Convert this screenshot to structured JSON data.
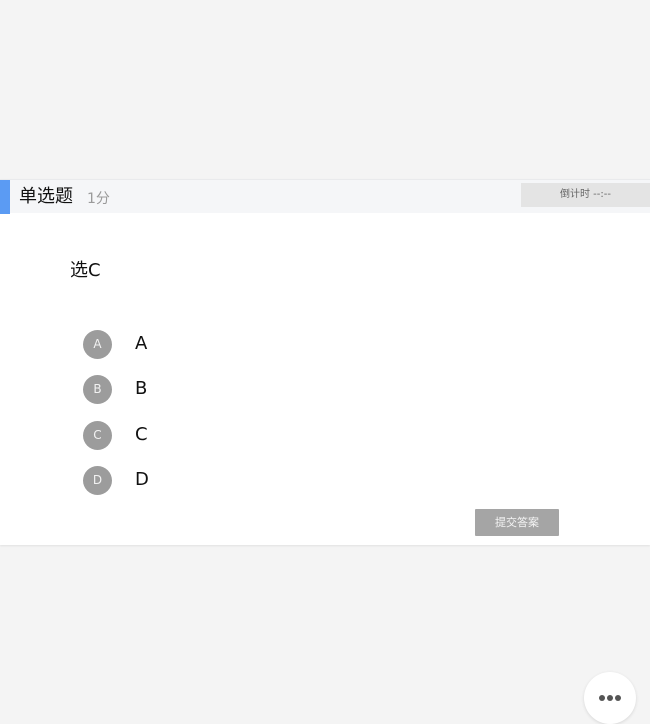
{
  "question": {
    "type_label": "单选题",
    "score_label": "1分",
    "timer_label": "倒计时 --:--",
    "text": "选C",
    "options": [
      {
        "letter": "A",
        "label": "A"
      },
      {
        "letter": "B",
        "label": "B"
      },
      {
        "letter": "C",
        "label": "C"
      },
      {
        "letter": "D",
        "label": "D"
      }
    ],
    "submit_label": "提交答案"
  },
  "fab": {
    "icon": "more-icon"
  },
  "colors": {
    "accent": "#5b9bf3",
    "option_circle": "#9c9c9c",
    "submit_button": "#a5a5a5",
    "page_background": "#f4f4f4"
  }
}
